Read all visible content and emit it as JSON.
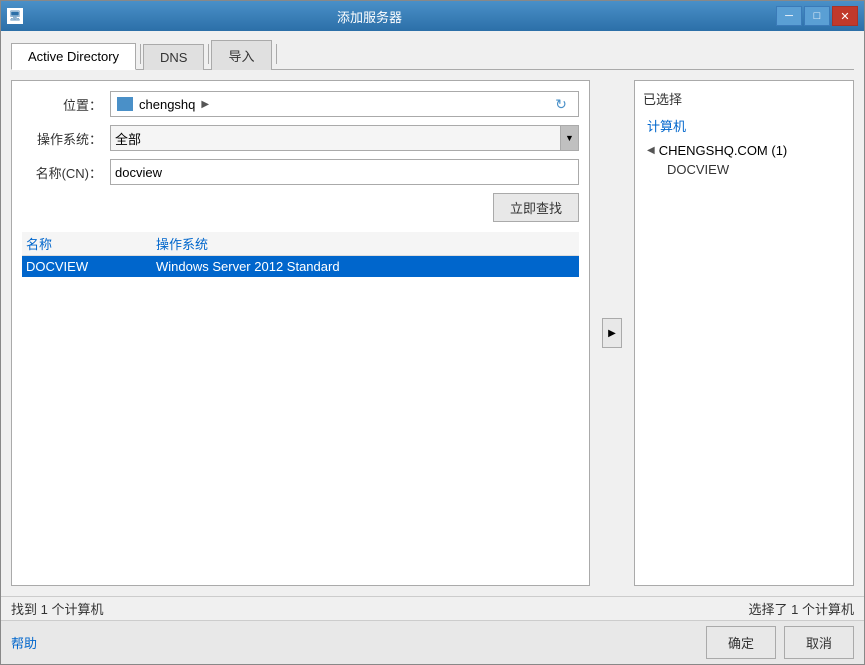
{
  "window": {
    "title": "添加服务器",
    "icon": "🖥"
  },
  "titlebar": {
    "minimize": "─",
    "maximize": "□",
    "close": "✕"
  },
  "tabs": [
    {
      "label": "Active Directory",
      "active": true
    },
    {
      "label": "DNS",
      "active": false
    },
    {
      "label": "导入",
      "active": false
    }
  ],
  "form": {
    "location_label": "位置：",
    "location_value": "chengshq",
    "location_arrow": "▶",
    "os_label": "操作系统：",
    "os_value": "全部",
    "name_label": "名称(CN)：",
    "name_value": "docview",
    "name_placeholder": "docview",
    "search_btn": "立即查找"
  },
  "results": {
    "col_name": "名称",
    "col_os": "操作系统",
    "rows": [
      {
        "name": "DOCVIEW",
        "os": "Windows Server 2012 Standard",
        "selected": true
      }
    ]
  },
  "status_left": "找到 1 个计算机",
  "right_panel": {
    "title": "已选择",
    "col_computers": "计算机",
    "group_name": "CHENGSHQ.COM (1)",
    "item": "DOCVIEW"
  },
  "status_right": "选择了 1 个计算机",
  "bottom": {
    "help": "帮助",
    "confirm": "确定",
    "cancel": "取消"
  },
  "transfer_icon": "▶"
}
